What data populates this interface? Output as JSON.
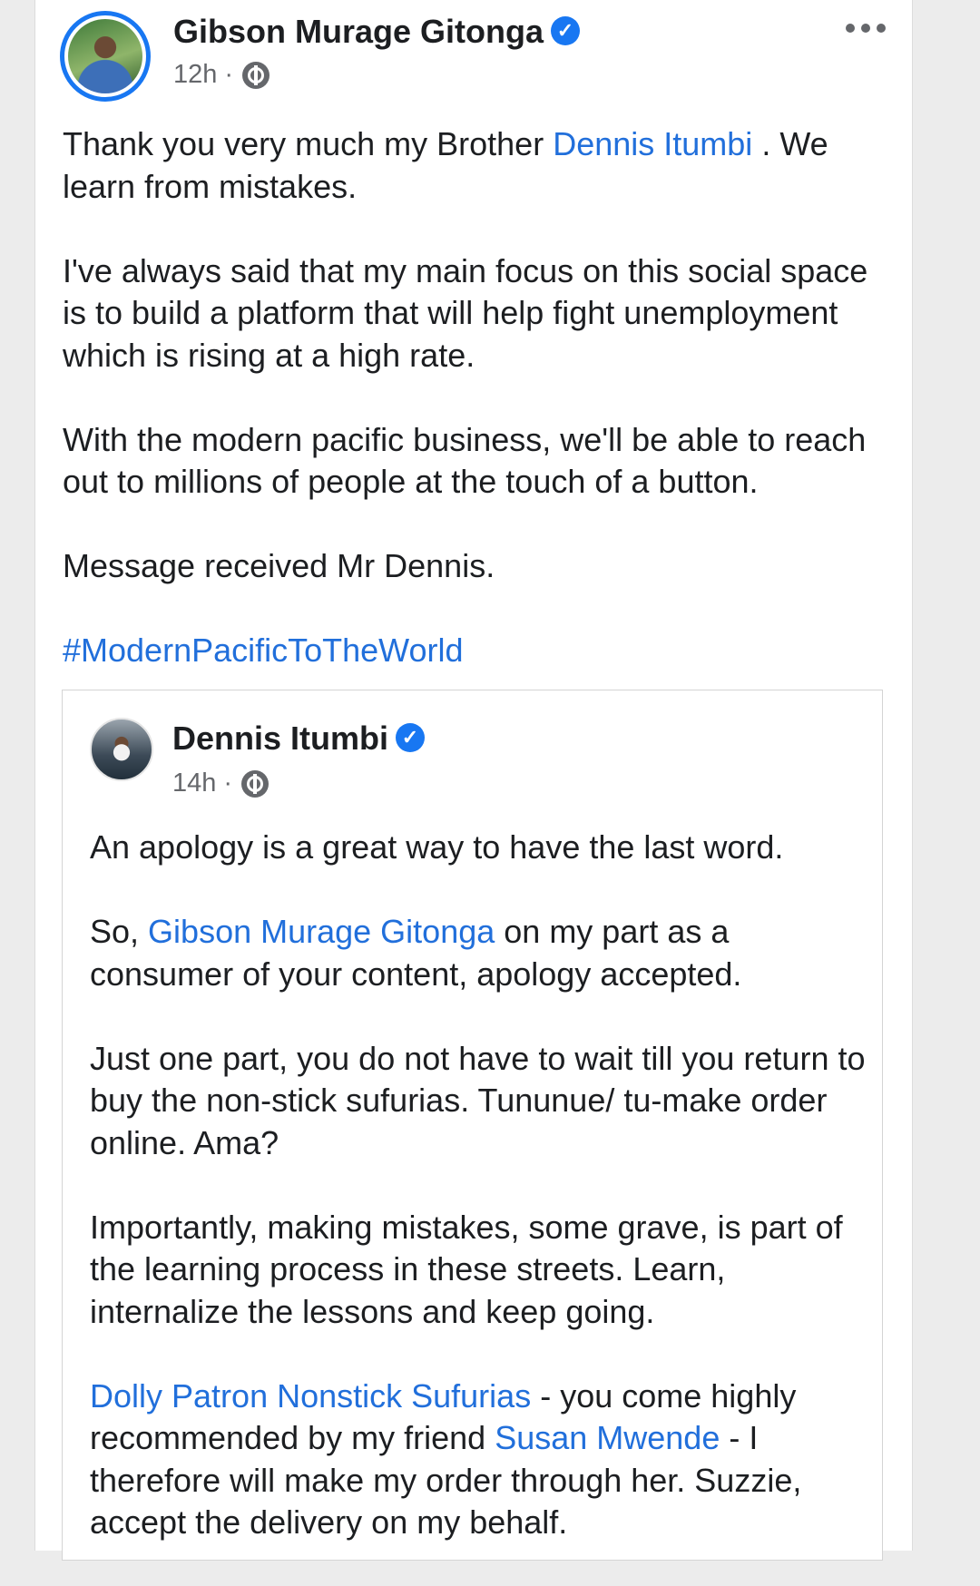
{
  "post": {
    "author": "Gibson Murage Gitonga",
    "time": "12h",
    "para1_a": "Thank you very much my Brother ",
    "para1_link": "Dennis Itumbi",
    "para1_b": " . We learn from mistakes.",
    "para2": "I've always said that my main focus on this social space is to build a platform that will help fight unemployment which is rising at a high rate.",
    "para3": "With the modern pacific business, we'll be able to reach out to millions of people at the touch of a button.",
    "para4": "Message received Mr Dennis.",
    "hashtag": "#ModernPacificToTheWorld"
  },
  "shared": {
    "author": "Dennis Itumbi",
    "time": "14h",
    "para1": "An apology is a great way to have the last word.",
    "para2_a": "So, ",
    "para2_link": "Gibson Murage Gitonga",
    "para2_b": "  on my part as a consumer of your content, apology accepted.",
    "para3": "Just one part, you do not have to wait till you return to buy the non-stick sufurias. Tununue/ tu-make order online. Ama?",
    "para4": "Importantly, making mistakes, some grave, is part of the learning process in these streets. Learn, internalize the lessons and keep going.",
    "para5_link1": "Dolly Patron Nonstick Sufurias",
    "para5_a": "  - you come highly recommended by my friend ",
    "para5_link2": "Susan Mwende",
    "para5_b": "   - I therefore will make my order through her. Suzzie, accept the delivery on my behalf."
  },
  "icons": {
    "verified": "verified-badge-icon",
    "privacy": "globe-icon",
    "more": "more-options-icon"
  },
  "colors": {
    "link": "#216fdb",
    "verified": "#1877f2",
    "meta": "#65676b"
  }
}
